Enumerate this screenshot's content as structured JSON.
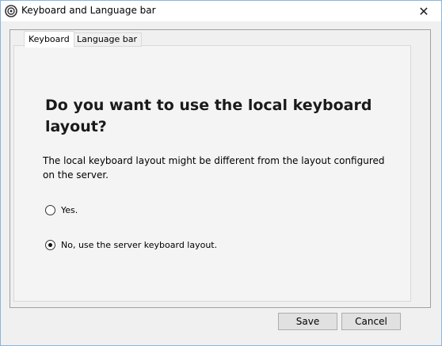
{
  "window": {
    "title": "Keyboard and Language bar",
    "close_glyph": "✕",
    "app_icon": "remote-desktop-icon"
  },
  "tabs": [
    {
      "label": "Keyboard",
      "active": true
    },
    {
      "label": "Language bar",
      "active": false
    }
  ],
  "main": {
    "heading": "Do you want to use the local keyboard layout?",
    "description": "The local keyboard layout might be different from the layout configured on the server.",
    "options": [
      {
        "label": "Yes.",
        "checked": false
      },
      {
        "label": "No, use the server keyboard layout.",
        "checked": true
      }
    ]
  },
  "footer": {
    "save_label": "Save",
    "cancel_label": "Cancel"
  }
}
